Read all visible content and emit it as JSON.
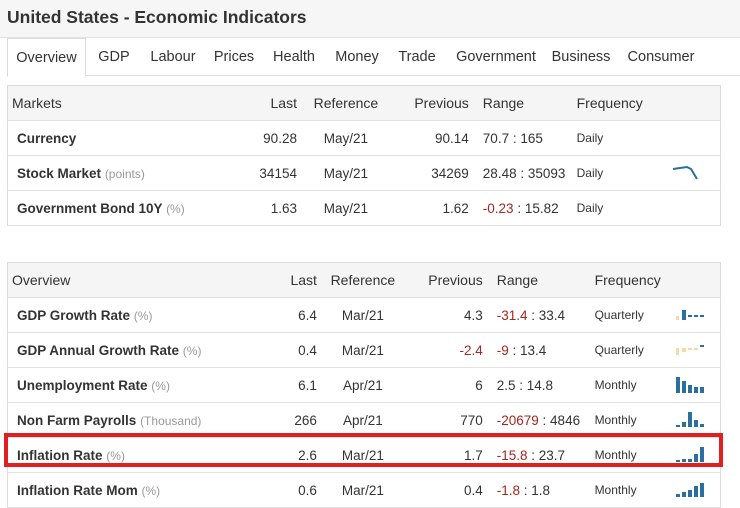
{
  "title": "United States - Economic Indicators",
  "tabs": [
    "Overview",
    "GDP",
    "Labour",
    "Prices",
    "Health",
    "Money",
    "Trade",
    "Government",
    "Business",
    "Consumer"
  ],
  "markets": {
    "headers": {
      "name": "Markets",
      "last": "Last",
      "reference": "Reference",
      "previous": "Previous",
      "range": "Range",
      "frequency": "Frequency"
    },
    "rows": [
      {
        "name": "Currency",
        "unit": "",
        "last": "90.28",
        "reference": "May/21",
        "previous": "90.14",
        "range_low": "70.7",
        "range_sep": " : ",
        "range_high": "165",
        "frequency": "Daily"
      },
      {
        "name": "Stock Market",
        "unit": "(points)",
        "last": "34154",
        "reference": "May/21",
        "previous": "34269",
        "range_low": "28.48",
        "range_sep": " : ",
        "range_high": "35093",
        "frequency": "Daily"
      },
      {
        "name": "Government Bond 10Y",
        "unit": "(%)",
        "last": "1.63",
        "reference": "May/21",
        "previous": "1.62",
        "range_low": "-0.23",
        "range_sep": " : ",
        "range_high": "15.82",
        "frequency": "Daily"
      }
    ]
  },
  "overview": {
    "headers": {
      "name": "Overview",
      "last": "Last",
      "reference": "Reference",
      "previous": "Previous",
      "range": "Range",
      "frequency": "Frequency"
    },
    "rows": [
      {
        "name": "GDP Growth Rate",
        "unit": "(%)",
        "last": "6.4",
        "reference": "Mar/21",
        "previous": "4.3",
        "range_low": "-31.4",
        "range_sep": " : ",
        "range_high": "33.4",
        "frequency": "Quarterly"
      },
      {
        "name": "GDP Annual Growth Rate",
        "unit": "(%)",
        "last": "0.4",
        "reference": "Mar/21",
        "previous": "-2.4",
        "range_low": "-9",
        "range_sep": " : ",
        "range_high": "13.4",
        "frequency": "Quarterly"
      },
      {
        "name": "Unemployment Rate",
        "unit": "(%)",
        "last": "6.1",
        "reference": "Apr/21",
        "previous": "6",
        "range_low": "2.5",
        "range_sep": " : ",
        "range_high": "14.8",
        "frequency": "Monthly"
      },
      {
        "name": "Non Farm Payrolls",
        "unit": "(Thousand)",
        "last": "266",
        "reference": "Apr/21",
        "previous": "770",
        "range_low": "-20679",
        "range_sep": " : ",
        "range_high": "4846",
        "frequency": "Monthly"
      },
      {
        "name": "Inflation Rate",
        "unit": "(%)",
        "last": "2.6",
        "reference": "Mar/21",
        "previous": "1.7",
        "range_low": "-15.8",
        "range_sep": " : ",
        "range_high": "23.7",
        "frequency": "Monthly"
      },
      {
        "name": "Inflation Rate Mom",
        "unit": "(%)",
        "last": "0.6",
        "reference": "Mar/21",
        "previous": "0.4",
        "range_low": "-1.8",
        "range_sep": " : ",
        "range_high": "1.8",
        "frequency": "Monthly"
      }
    ]
  },
  "colors": {
    "accent_blue": "#2b6ea0",
    "negative_red": "#a1271f",
    "highlight_red": "#e02020",
    "spark_beige": "#f2d9a8"
  },
  "icons": {
    "sparkline": "sparkline-chart-icon"
  }
}
